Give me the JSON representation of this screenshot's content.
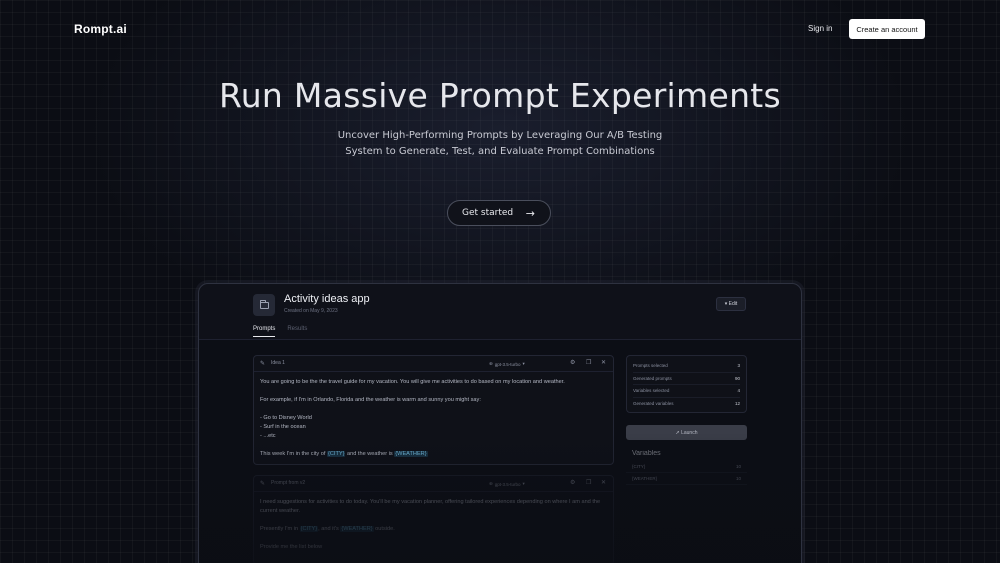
{
  "nav": {
    "logo": "Rompt.ai",
    "sign_in": "Sign in",
    "create_account": "Create an account"
  },
  "hero": {
    "title": "Run Massive Prompt Experiments",
    "subtitle_line1": "Uncover High-Performing Prompts by Leveraging Our A/B Testing",
    "subtitle_line2": "System to Generate, Test, and Evaluate Prompt Combinations",
    "cta": "Get started"
  },
  "app": {
    "project_title": "Activity ideas app",
    "created": "Created on May 9, 2023",
    "edit": "Edit",
    "tabs": [
      {
        "label": "Prompts",
        "active": true
      },
      {
        "label": "Results",
        "active": false
      }
    ],
    "prompt1": {
      "name": "Idea 1",
      "model": "gpt-3.5-turbo",
      "line1": "You are going to be the the travel guide for my vacation. You will give me activities to do based on my location and weather.",
      "line2": "For example, if I'm in Orlando, Florida and the weather is warm and sunny you might say:",
      "line3": "- Go to Disney World\n- Surf in the ocean\n- ...etc",
      "line4_before": "This week I'm in the city of ",
      "var_city": "{CITY}",
      "line4_mid": " and the weather is ",
      "var_weather": "{WEATHER}"
    },
    "prompt2": {
      "name": "Prompt from v2",
      "model": "gpt-3.5-turbo",
      "line1": "I need suggestions for activities to do today. You'll be my vacation planner, offering tailored experiences depending on where I am and the current weather.",
      "line2_before": "Presently I'm in ",
      "var_city": "{CITY}",
      "line2_mid": ", and it's ",
      "var_weather": "{WEATHER}",
      "line2_after": " outside.",
      "line3": "Provide me the list below"
    },
    "stats": [
      {
        "label": "Prompts selected",
        "value": "3"
      },
      {
        "label": "Generated prompts",
        "value": "90"
      },
      {
        "label": "Variables selected",
        "value": "4"
      },
      {
        "label": "Generated variables",
        "value": "12"
      }
    ],
    "launch": "Launch",
    "variables": {
      "title": "Variables",
      "rows": [
        {
          "label": "{CITY}",
          "value": "10"
        },
        {
          "label": "{WEATHER}",
          "value": "10"
        }
      ]
    }
  },
  "icons": {
    "arrow": "arrow-right-icon",
    "folder": "folder-icon"
  }
}
